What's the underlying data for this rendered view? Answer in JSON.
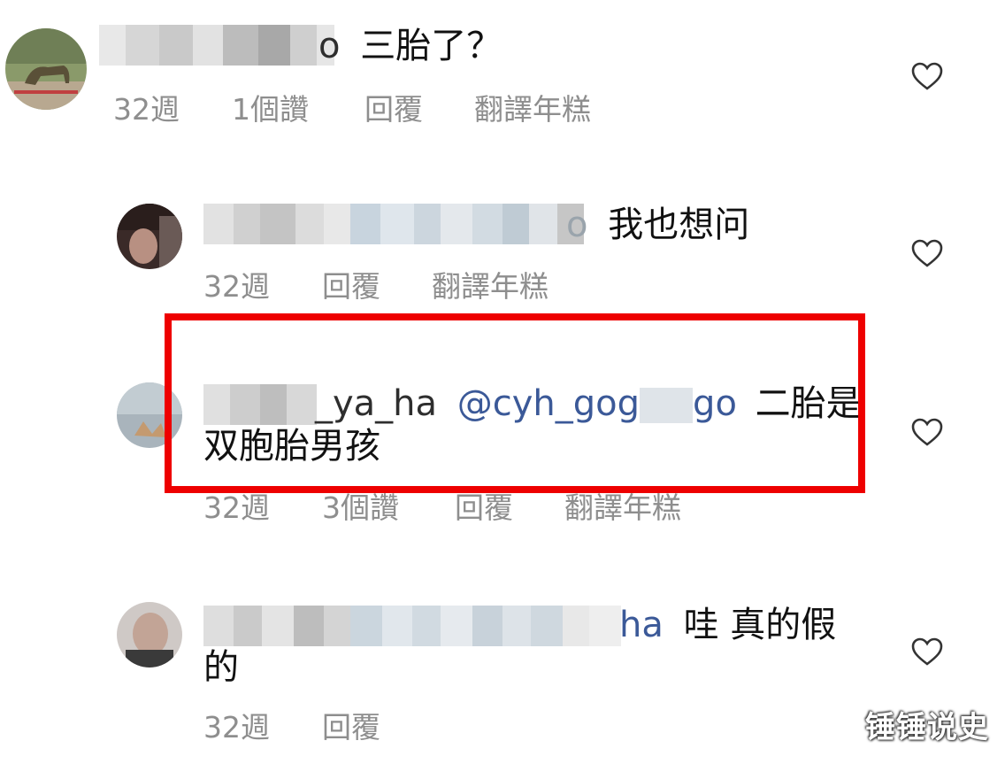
{
  "comments": [
    {
      "username_tail": "o",
      "text": "三胎了？",
      "time": "32週",
      "likes": "1個讚",
      "reply": "回覆",
      "translate": "翻譯年糕"
    },
    {
      "username_tail": "o",
      "text": "我也想问",
      "time": "32週",
      "reply": "回覆",
      "translate": "翻譯年糕"
    },
    {
      "username_visible": "_ya_ha",
      "mention": "@cyh_gog",
      "mention_tail": "go",
      "text_line1": "二胎是",
      "text_line2": "双胞胎男孩",
      "time": "32週",
      "likes": "3個讚",
      "reply": "回覆",
      "translate": "翻譯年糕"
    },
    {
      "username_tail": "ha",
      "text_line1": "哇 真的假",
      "text_line2": "的",
      "time": "32週",
      "reply": "回覆"
    }
  ],
  "watermark": "锤锤说史",
  "colors": {
    "highlight_border": "#ee0000",
    "meta_text": "#8e8e8e",
    "mention": "#3b5998"
  },
  "icons": [
    "heart-icon"
  ]
}
